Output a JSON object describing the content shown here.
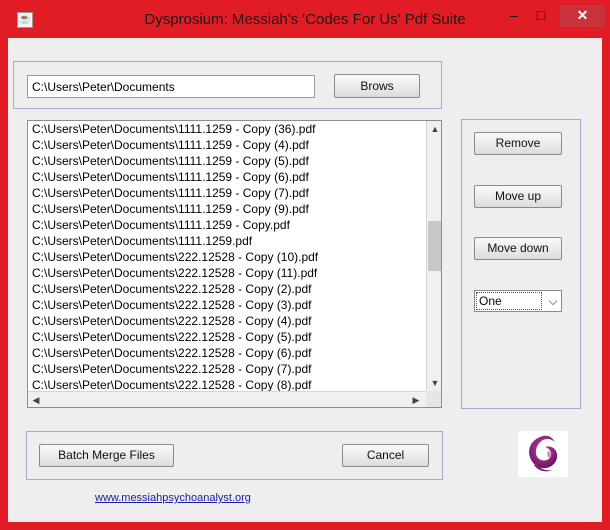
{
  "window": {
    "title": "Dysprosium: Messiah's 'Codes For Us' Pdf Suite",
    "app_icon": "java-cup-icon",
    "controls": {
      "minimize": "–",
      "maximize": "□",
      "close": "✕"
    }
  },
  "path_panel": {
    "path_value": "C:\\Users\\Peter\\Documents",
    "browse_label": "Brows"
  },
  "file_list": {
    "items": [
      "C:\\Users\\Peter\\Documents\\1111.1259 - Copy (36).pdf",
      "C:\\Users\\Peter\\Documents\\1111.1259 - Copy (4).pdf",
      "C:\\Users\\Peter\\Documents\\1111.1259 - Copy (5).pdf",
      "C:\\Users\\Peter\\Documents\\1111.1259 - Copy (6).pdf",
      "C:\\Users\\Peter\\Documents\\1111.1259 - Copy (7).pdf",
      "C:\\Users\\Peter\\Documents\\1111.1259 - Copy (9).pdf",
      "C:\\Users\\Peter\\Documents\\1111.1259 - Copy.pdf",
      "C:\\Users\\Peter\\Documents\\1111.1259.pdf",
      "C:\\Users\\Peter\\Documents\\222.12528 - Copy (10).pdf",
      "C:\\Users\\Peter\\Documents\\222.12528 - Copy (11).pdf",
      "C:\\Users\\Peter\\Documents\\222.12528 - Copy (2).pdf",
      "C:\\Users\\Peter\\Documents\\222.12528 - Copy (3).pdf",
      "C:\\Users\\Peter\\Documents\\222.12528 - Copy (4).pdf",
      "C:\\Users\\Peter\\Documents\\222.12528 - Copy (5).pdf",
      "C:\\Users\\Peter\\Documents\\222.12528 - Copy (6).pdf",
      "C:\\Users\\Peter\\Documents\\222.12528 - Copy (7).pdf",
      "C:\\Users\\Peter\\Documents\\222.12528 - Copy (8).pdf"
    ]
  },
  "side_panel": {
    "remove_label": "Remove",
    "move_up_label": "Move up",
    "move_down_label": "Move down",
    "combo_value": "One"
  },
  "bottom_panel": {
    "batch_merge_label": "Batch Merge Files",
    "cancel_label": "Cancel"
  },
  "footer": {
    "link_text": "www.messiahpsychoanalyst.org"
  },
  "colors": {
    "window_frame": "#e21c24",
    "panel_border": "#a8a8d8",
    "logo_purple": "#8a1c7c"
  }
}
